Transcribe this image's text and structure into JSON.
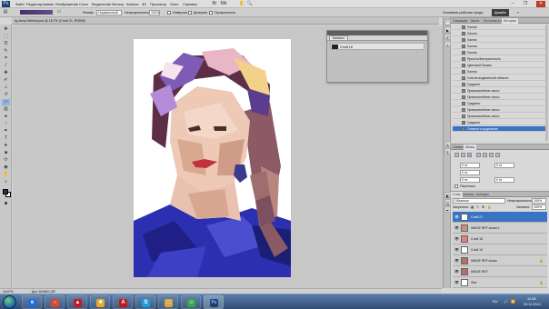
{
  "app": {
    "logo": "Ps"
  },
  "menu": [
    "Файл",
    "Редактирование",
    "Изображение",
    "Слои",
    "Выделение",
    "Фильтр",
    "Анализ",
    "3D",
    "Просмотр",
    "Окно",
    "Справка"
  ],
  "options_bar": {
    "mode_label": "Режим:",
    "mode_value": "Нормальный",
    "opacity_label": "Непрозрачность:",
    "opacity_value": "100%",
    "inverse_label": "Инверсия",
    "dither_label": "Дизеринг",
    "transparency_label": "Прозрачность"
  },
  "workspace": {
    "current": "Основная рабочая среда",
    "design": "Дизайн",
    "more": "»"
  },
  "document": {
    "tab_title": "by Anna Werbel.psd @ 16,7% (Слой 21, RGB/8)"
  },
  "floating_panel": {
    "tab": "Каналы",
    "item": "Слой 18"
  },
  "history": {
    "tabs": [
      "Операции",
      "Кисти",
      "Источник кл.",
      "История"
    ],
    "items": [
      "Ластик",
      "Ластик",
      "Ластик",
      "Ластик",
      "Ластик",
      "Яркость/Контрастность",
      "Цветовой баланс",
      "Ластик",
      "Снятие выделенной области",
      "Градиент",
      "Прямолинейное лассо",
      "Прямолинейное лассо",
      "Градиент",
      "Прямолинейное лассо",
      "Прямолинейное лассо",
      "Градиент",
      "Отменить выделение"
    ],
    "selected_index": 16
  },
  "paragraph": {
    "tabs": [
      "Символ",
      "Абзац"
    ],
    "indent_left": "0 пт",
    "indent_right": "0 пт",
    "first_line": "0 пт",
    "space_before": "0 пт",
    "space_after": "0 пт",
    "hyphenation": "Переносы"
  },
  "layers": {
    "tabs": [
      "Слои",
      "Каналы",
      "Контуры"
    ],
    "blend_mode": "Обычные",
    "opacity_label": "Непрозрачность:",
    "opacity_value": "100%",
    "lock_label": "Закрепить:",
    "fill_label": "Заливка:",
    "fill_value": "100%",
    "items": [
      {
        "name": "Слой 21",
        "thumb": "#ffffff",
        "selected": true,
        "locked": false
      },
      {
        "name": "IMAGE REF копия 2",
        "thumb": "#c98f86",
        "selected": false,
        "locked": false
      },
      {
        "name": "Слой 18",
        "thumb": "#e3826e",
        "selected": false,
        "locked": false
      },
      {
        "name": "Слой 15",
        "thumb": "#ffffff",
        "selected": false,
        "locked": false
      },
      {
        "name": "IMAGE REF копия",
        "thumb": "#b27066",
        "selected": false,
        "locked": true
      },
      {
        "name": "IMAGE REF",
        "thumb": "#b27066",
        "selected": false,
        "locked": false
      },
      {
        "name": "Фон",
        "thumb": "#ffffff",
        "selected": false,
        "locked": true
      }
    ]
  },
  "statusbar": {
    "zoom": "16,67%",
    "doc": "Док: 46,8M/1,53Г"
  },
  "taskbar": {
    "apps": [
      {
        "glyph": "e",
        "color": "#1e6ed6"
      },
      {
        "glyph": "○",
        "color": "#d84a2b"
      },
      {
        "glyph": "▲",
        "color": "#c41b1b"
      },
      {
        "glyph": "■",
        "color": "#e7a92a"
      },
      {
        "glyph": "A",
        "color": "#c81717"
      },
      {
        "glyph": "S",
        "color": "#1aa0e0"
      },
      {
        "glyph": "□",
        "color": "#d6a83a"
      },
      {
        "glyph": "☺",
        "color": "#3aa64a"
      },
      {
        "glyph": "Ps",
        "color": "#1d3f73"
      }
    ],
    "lang": "RU",
    "time": "12:08",
    "date": "23.11.2014"
  },
  "colors": {
    "foreground": "#3b2a5e",
    "background": "#ffffff",
    "selection": "#3a73c4"
  }
}
